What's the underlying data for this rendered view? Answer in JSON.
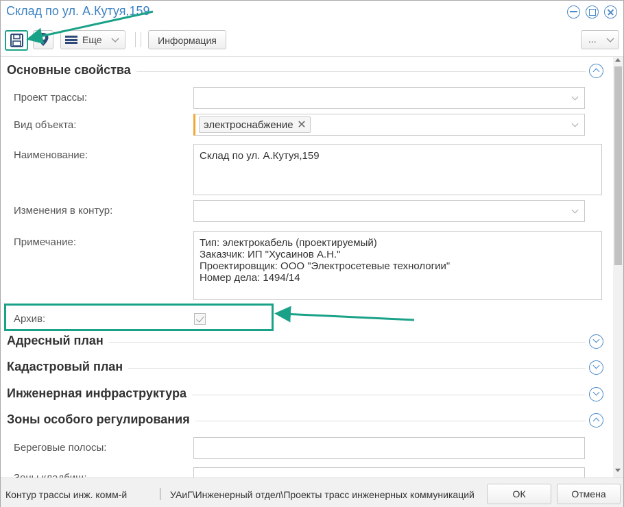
{
  "window": {
    "title": "Склад по ул. А.Кутуя,159",
    "controls": [
      "minimize-icon",
      "maximize-icon",
      "close-icon"
    ]
  },
  "toolbar": {
    "save_icon": "floppy-disk-icon",
    "pin_icon": "map-pin-icon",
    "more_label": "Еще",
    "info_label": "Информация",
    "dots_label": "..."
  },
  "sections": {
    "main": "Основные свойства",
    "address": "Адресный план",
    "cadastral": "Кадастровый план",
    "engineering": "Инженерная инфраструктура",
    "zones": "Зоны особого регулирования"
  },
  "fields": {
    "route_project": {
      "label": "Проект трассы:",
      "value": ""
    },
    "object_type": {
      "label": "Вид объекта:",
      "tag": "электроснабжение"
    },
    "name": {
      "label": "Наименование:",
      "value": "Склад по ул. А.Кутуя,159"
    },
    "contour_changes": {
      "label": "Изменения в контур:",
      "value": ""
    },
    "note": {
      "label": "Примечание:",
      "lines": [
        "Тип: электрокабель (проектируемый)",
        "Заказчик: ИП \"Хусаинов А.Н.\"",
        "Проектировщик: ООО \"Электросетевые технологии\"",
        "Номер дела: 1494/14"
      ]
    },
    "archive": {
      "label": "Архив:",
      "checked": true
    },
    "coastal": {
      "label": "Береговые полосы:",
      "value": ""
    },
    "cemetery": {
      "label": "Зоны кладбищ:",
      "value": ""
    }
  },
  "statusbar": {
    "left": "Контур трассы инж. комм-й",
    "path": "УАиГ\\Инженерный отдел\\Проекты трасс инженерных коммуникаций",
    "ok": "ОК",
    "cancel": "Отмена"
  },
  "colors": {
    "accent": "#3c83c4",
    "annotation": "#1aa288",
    "required": "#f0a832"
  }
}
